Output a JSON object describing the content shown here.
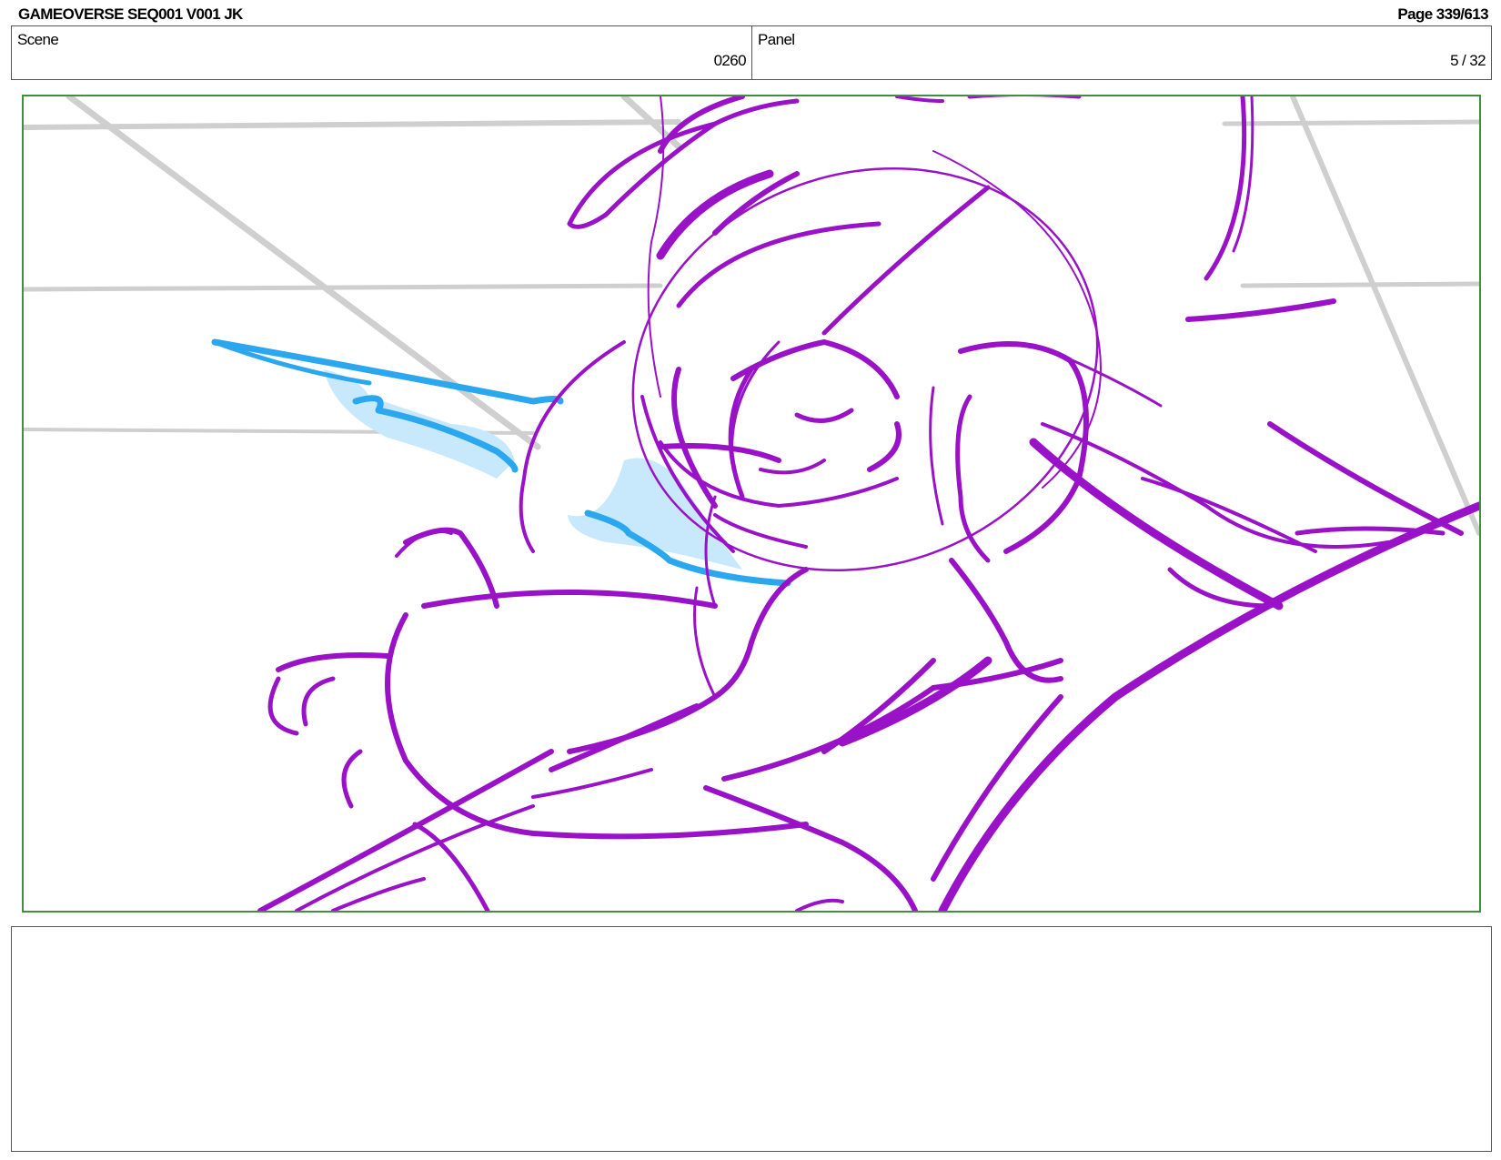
{
  "header": {
    "project_title": "GAMEOVERSE SEQ001 V001 JK",
    "page_label": "Page 339/613"
  },
  "info": {
    "scene_label": "Scene",
    "scene_value": "0260",
    "panel_label": "Panel",
    "panel_value": "5 / 32"
  },
  "panel_art": {
    "description_type": "storyboard-sketch",
    "line_color": "#9a12c8",
    "accent_color": "#2aa7ef",
    "accent_fill": "#c8e8fb",
    "guide_color": "#cfcfcf",
    "frame_color": "#3f8f3f"
  },
  "notes": {
    "text": ""
  }
}
